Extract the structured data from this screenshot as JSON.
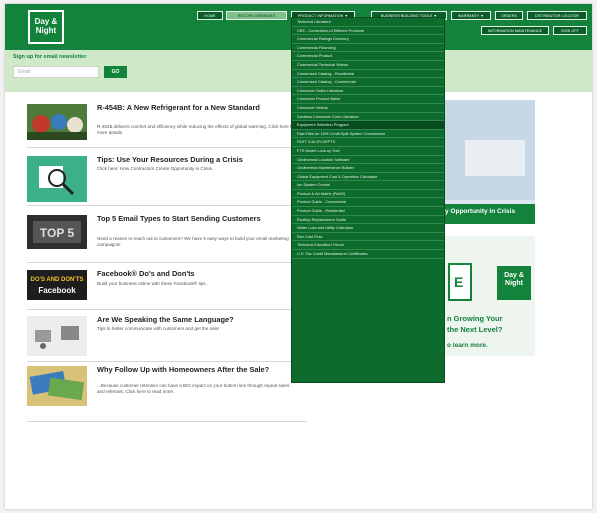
{
  "header": {
    "logo_text": "Day & Night",
    "nav": [
      {
        "label": "HOME"
      },
      {
        "label": "RECORD WEBINARS"
      },
      {
        "label": "PRODUCT INFORMATION ▼"
      },
      {
        "label": "BUSINESS BUILDING TOOLS ▼"
      },
      {
        "label": "WARRANTY ▼"
      },
      {
        "label": "ORDERS"
      },
      {
        "label": "DISTRIBUTOR LOCATOR"
      },
      {
        "label": "INFORMATION MAINTENANCE"
      },
      {
        "label": "SIGN OFF"
      }
    ]
  },
  "newsletter": {
    "label": "Sign up for email newsletter",
    "placeholder": "Email",
    "button": "GO"
  },
  "articles": [
    {
      "title": "R-454B: A New Refrigerant for a New Standard",
      "desc": "R-454B delivers comfort and efficiency while reducing the effects of global warming. Click here for more details."
    },
    {
      "title": "Tips: Use Your Resources During a Crisis",
      "desc": "Click here: How Contractors Create Opportunity in Crisis."
    },
    {
      "title": "Top 5 Email Types to Start Sending Customers",
      "desc": "Need a reason to reach out to customers? We have 5 easy ways to build your email marketing campaigns!"
    },
    {
      "title": "Facebook® Do's and Don'ts",
      "desc": "Build your business online with these Facebook® tips."
    },
    {
      "title": "Are We Speaking the Same Language?",
      "desc": "Tips to better communicate with customers and get the sale!"
    },
    {
      "title": "Why Follow Up with Homeowners After the Sale?",
      "desc": "...Because customer retention can have a BIG impact on your bottom line through repeat sales and referrals. Click here to read more."
    }
  ],
  "thumb_texts": {
    "email_top5": "TOP 5",
    "facebook_tag": "DO'S AND DON'TS",
    "facebook_word": "Facebook"
  },
  "menu": [
    "Technical Literature",
    "CEE - Consortium of Efficient Products",
    "Commercial Ratings Directory",
    "Commercial Financing",
    "Commercial Product",
    "Commercial Technical Videos",
    "Condensed Catalog - Residential",
    "Condensed Catalog - Commercial",
    "Consumer Sales Literature",
    "Consumer Product Ballot",
    "Consumer Videos",
    "Ductless Consumer Color Literature",
    "Equipment Selection Program",
    "Fast Files for 15% Credit Split System Commission",
    "FAST ICAC/R-DEPTS",
    "FTR Model Look-up Tool",
    "Geothermal Location Software",
    "Geothermal Maintenance Builder",
    "Global Equipment Cost & Operation Calculator",
    "Ion System Control",
    "Product & Ad Matrix (PAAS)",
    "Product Guide - Commercial",
    "Product Guide - Residential",
    "Rooftop Replacement Guide",
    "Water Loss and Utility Calculator",
    "Rev Cost Flow",
    "Technical Education Forum",
    "U.S. Tax Credit Manufacturer Certificates"
  ],
  "menu_active_index": 12,
  "promo1": {
    "caption": "y Opportunity in Crisis"
  },
  "promo2": {
    "brand": "Day & Night",
    "big_letter": "E",
    "line1": "n Growing Your",
    "line2": "the Next Level?",
    "line3": "o learn more."
  },
  "colors": {
    "brand_green": "#13823b",
    "dark_green": "#0a5e27",
    "menu_green": "#0c6b2d",
    "news_bg": "#cfe8c7"
  }
}
